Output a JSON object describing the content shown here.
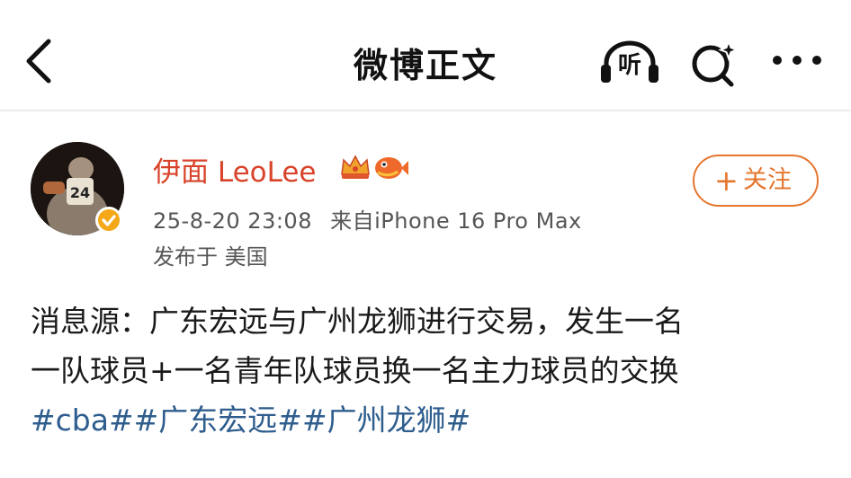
{
  "header": {
    "title": "微博正文",
    "listen_label": "听"
  },
  "author": {
    "name": "伊面 LeoLee",
    "timestamp": "25-8-20 23:08",
    "source": "来自iPhone 16 Pro Max",
    "location": "发布于 美国",
    "verified": true,
    "avatar_jersey_number": "24"
  },
  "follow_button": {
    "plus": "+",
    "label": "关注"
  },
  "post": {
    "line1": "消息源：广东宏远与广州龙狮进行交易，发生一名",
    "line2": "一队球员+一名青年队球员换一名主力球员的交换",
    "tags": [
      "#cba#",
      "#广东宏远#",
      "#广州龙狮#"
    ]
  },
  "icons": {
    "back": "chevron-left-icon",
    "listen": "headphones-icon",
    "search": "sparkle-search-icon",
    "more": "more-dots-icon",
    "badge1": "crown-badge-icon",
    "badge2": "fish-badge-icon",
    "verify": "verified-badge-icon"
  },
  "colors": {
    "username": "#d8432a",
    "follow": "#e5762e",
    "tag": "#2e5d8e",
    "verify": "#f4a818"
  }
}
